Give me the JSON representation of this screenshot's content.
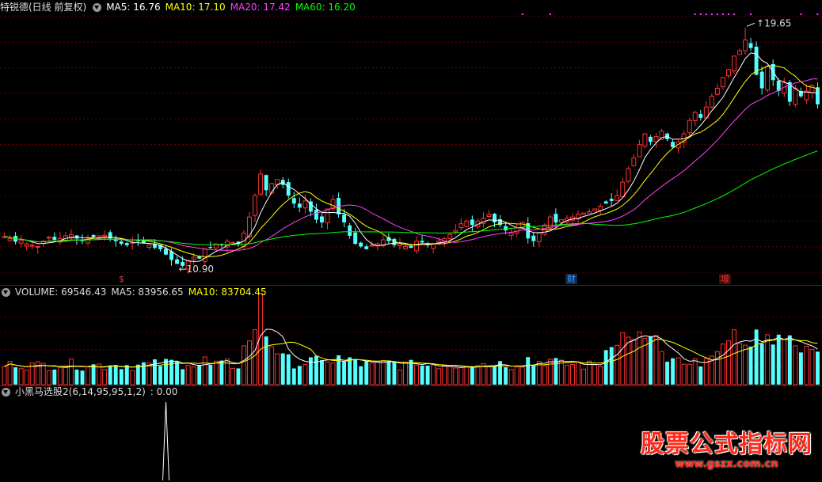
{
  "price_panel": {
    "title": "特锐德(日线 前复权)",
    "ma": [
      {
        "label": "MA5: 16.76",
        "color": "#ffffff"
      },
      {
        "label": "MA10: 17.10",
        "color": "#ffff00"
      },
      {
        "label": "MA20: 17.42",
        "color": "#ff40ff"
      },
      {
        "label": "MA60: 16.20",
        "color": "#00ff00"
      }
    ],
    "high_label": "19.65",
    "low_label": "10.90",
    "markers": [
      {
        "label": "$",
        "color": "#ff3030"
      },
      {
        "label": "财",
        "color": "#3aa0ff"
      },
      {
        "label": "增",
        "color": "#ff3030"
      }
    ]
  },
  "volume_panel": {
    "items": [
      {
        "label": "VOLUME: 69546.43",
        "color": "#dcdcdc"
      },
      {
        "label": "MA5: 83956.65",
        "color": "#dcdcdc"
      },
      {
        "label": "MA10: 83704.45",
        "color": "#ffff00"
      }
    ]
  },
  "indicator_panel": {
    "label": "小黑马选股2(6,14,95,95,1,2)",
    "value": ": 0.00"
  },
  "watermark": {
    "main": "股票公式指标网",
    "url": "www.gszx.com.cn"
  },
  "chart_data": {
    "type": "candlestick",
    "series_close": [
      11.88,
      11.8,
      11.68,
      11.72,
      11.6,
      11.55,
      11.5,
      11.7,
      11.85,
      11.75,
      11.8,
      11.9,
      11.95,
      11.8,
      11.7,
      11.78,
      11.85,
      11.9,
      11.92,
      11.8,
      11.7,
      11.6,
      11.55,
      11.65,
      11.7,
      11.62,
      11.55,
      11.45,
      11.4,
      11.2,
      11.0,
      10.85,
      10.78,
      10.98,
      11.1,
      11.05,
      11.4,
      11.45,
      11.6,
      11.55,
      11.7,
      11.65,
      11.6,
      12.0,
      12.6,
      13.4,
      14.2,
      13.6,
      13.85,
      14.0,
      13.8,
      13.4,
      13.1,
      12.95,
      13.2,
      12.8,
      12.5,
      12.4,
      12.9,
      13.25,
      12.7,
      12.4,
      11.9,
      11.6,
      11.5,
      11.4,
      11.55,
      11.6,
      11.75,
      11.7,
      11.55,
      11.6,
      11.5,
      11.45,
      11.7,
      11.65,
      11.55,
      11.6,
      11.7,
      11.8,
      11.95,
      12.1,
      12.35,
      12.45,
      12.3,
      12.45,
      12.55,
      12.7,
      12.4,
      12.3,
      12.1,
      12.0,
      12.2,
      12.4,
      11.8,
      11.7,
      12.0,
      12.3,
      12.6,
      12.4,
      12.5,
      12.55,
      12.6,
      12.7,
      12.75,
      12.8,
      12.9,
      13.0,
      13.1,
      13.2,
      13.4,
      13.9,
      14.4,
      14.8,
      15.3,
      15.7,
      15.4,
      15.6,
      15.8,
      15.5,
      15.2,
      15.4,
      15.7,
      16.2,
      16.5,
      16.3,
      16.7,
      17.1,
      17.4,
      17.8,
      18.1,
      18.6,
      18.8,
      19.2,
      18.9,
      17.9,
      17.4,
      18.2,
      17.7,
      17.3,
      17.6,
      16.9,
      17.4,
      17.1,
      17.3,
      17.5,
      16.8
    ],
    "ma5_last": 16.76,
    "ma10_last": 17.1,
    "ma20_last": 17.42,
    "ma60_last": 16.2,
    "price_high": 19.65,
    "price_low": 10.9,
    "ylim": [
      10.6,
      20.1
    ],
    "volume_last": 69546.43,
    "vol_ma5_last": 83956.65,
    "vol_ma10_last": 83704.45,
    "indicator_last": 0.0,
    "indicator_spike_index": 29,
    "markers_index": [
      20,
      95,
      120
    ]
  }
}
